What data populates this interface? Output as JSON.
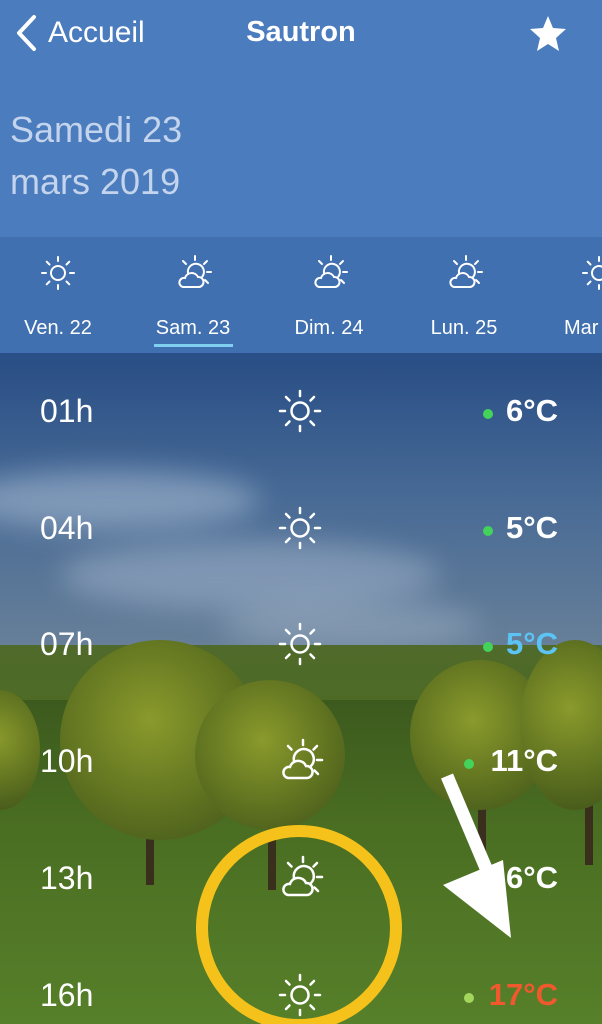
{
  "header": {
    "back_label": "Accueil",
    "city": "Sautron",
    "date_line1": "Samedi 23",
    "date_line2": "mars 2019",
    "back_icon": "chevron-left-icon",
    "favorite_icon": "star-icon"
  },
  "days": [
    {
      "label": "Ven. 22",
      "icon": "sun-icon"
    },
    {
      "label": "Sam. 23",
      "icon": "partly-cloudy-icon",
      "selected": true
    },
    {
      "label": "Dim. 24",
      "icon": "partly-cloudy-icon"
    },
    {
      "label": "Lun. 25",
      "icon": "partly-cloudy-icon"
    },
    {
      "label": "Mar",
      "icon": "sun-icon"
    }
  ],
  "hours": [
    {
      "hour": "01h",
      "icon": "sun-icon",
      "temp": "6°C",
      "temp_color": "#ffffff",
      "dot_color": "#44d35a"
    },
    {
      "hour": "04h",
      "icon": "sun-icon",
      "temp": "5°C",
      "temp_color": "#ffffff",
      "dot_color": "#44d35a"
    },
    {
      "hour": "07h",
      "icon": "sun-icon",
      "temp": "5°C",
      "temp_color": "#5bc4f5",
      "dot_color": "#44d35a"
    },
    {
      "hour": "10h",
      "icon": "partly-cloudy-icon",
      "temp": "11°C",
      "temp_color": "#ffffff",
      "dot_color": "#44d35a"
    },
    {
      "hour": "13h",
      "icon": "partly-cloudy-icon",
      "temp": "6°C",
      "temp_color": "#ffffff",
      "dot_color": "#44d35a"
    },
    {
      "hour": "16h",
      "icon": "sun-icon",
      "temp": "17°C",
      "temp_color": "#f0582e",
      "dot_color": "#a4d65e"
    }
  ],
  "colors": {
    "header_bg": "#4b7cbd",
    "daystrip_bg": "#4070b0",
    "selected_underline": "#7fd0f0",
    "annotation_circle": "#f5c21b",
    "annotation_arrow": "#ffffff"
  }
}
